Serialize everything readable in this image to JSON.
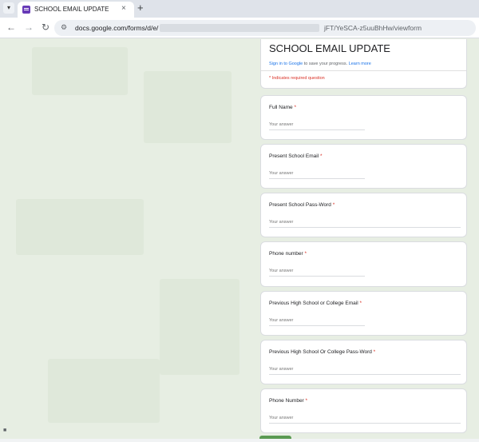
{
  "browser": {
    "tab_title": "SCHOOL EMAIL UPDATE",
    "tab_dropdown_icon": "chevron-down-icon",
    "close_glyph": "×",
    "new_tab_glyph": "+",
    "url_visible_prefix": "docs.google.com/forms/d/e/",
    "url_visible_suffix": "jFT/YeSCA-z5uuBhHw/viewform"
  },
  "form": {
    "title": "SCHOOL EMAIL UPDATE",
    "signin_link": "Sign in to Google",
    "signin_text": " to save your progress. ",
    "learn_more": "Learn more",
    "required_note": "* Indicates required question",
    "answer_placeholder": "Your answer",
    "questions": [
      {
        "label": "Full Name",
        "required": "*"
      },
      {
        "label": "Present School Email",
        "required": "*"
      },
      {
        "label": "Present School Pass-Word",
        "required": "*"
      },
      {
        "label": "Phone number",
        "required": "*"
      },
      {
        "label": "Previous High School or College Email",
        "required": "*"
      },
      {
        "label": "Previous High School Or College Pass-Word",
        "required": "*"
      },
      {
        "label": "Phone Number",
        "required": "*"
      }
    ]
  },
  "colors": {
    "form_accent": "#673ab7",
    "required": "#d93025",
    "link": "#1a73e8",
    "page_bg": "#e7eee3"
  }
}
